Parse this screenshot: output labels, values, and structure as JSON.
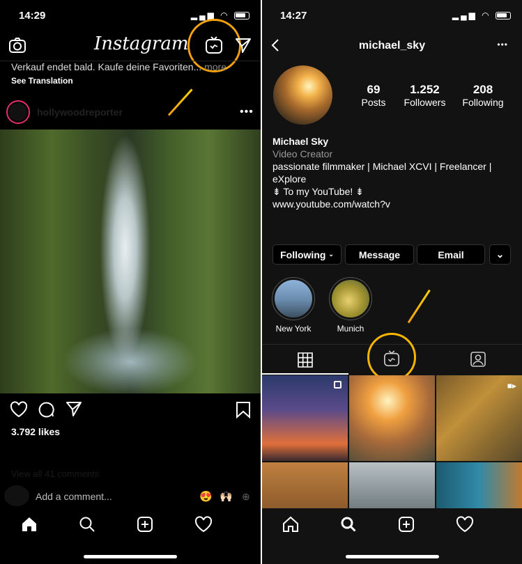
{
  "left": {
    "time": "14:29",
    "logo": "Instagram",
    "caption": "Verkauf endet bald. Kaufe deine Favoriten...",
    "caption_more": "more",
    "see_translation": "See Translation",
    "post_user": "hollywoodreporter",
    "likes": "3.792 likes",
    "view_comments": "View all 41 comments",
    "comment_placeholder": "Add a comment...",
    "emojis": [
      "😍",
      "🙌🏻"
    ],
    "icons": [
      "camera-icon",
      "igtv-icon",
      "send-icon",
      "heart-icon",
      "comment-icon",
      "share-icon",
      "bookmark-icon",
      "home-icon",
      "search-icon",
      "add-icon",
      "activity-icon"
    ]
  },
  "right": {
    "time": "14:27",
    "username": "michael_sky",
    "stats": [
      {
        "value": "69",
        "label": "Posts"
      },
      {
        "value": "1.252",
        "label": "Followers"
      },
      {
        "value": "208",
        "label": "Following"
      }
    ],
    "name": "Michael Sky",
    "category": "Video Creator",
    "bio_lines": [
      "passionate filmmaker | Michael XCVI | Freelancer |",
      "eXplore",
      "⇟ To my YouTube! ⇟",
      "www.youtube.com/watch?v"
    ],
    "buttons": {
      "following": "Following",
      "message": "Message",
      "email": "Email"
    },
    "highlights": [
      {
        "label": "New York"
      },
      {
        "label": "Munich"
      }
    ],
    "tabs": [
      "grid-icon",
      "igtv-icon",
      "tagged-icon"
    ]
  },
  "colors": {
    "highlight_ring": "#f7a20c",
    "arrow": "#ffc107",
    "background_left": "#000000",
    "background_right": "#121212"
  }
}
